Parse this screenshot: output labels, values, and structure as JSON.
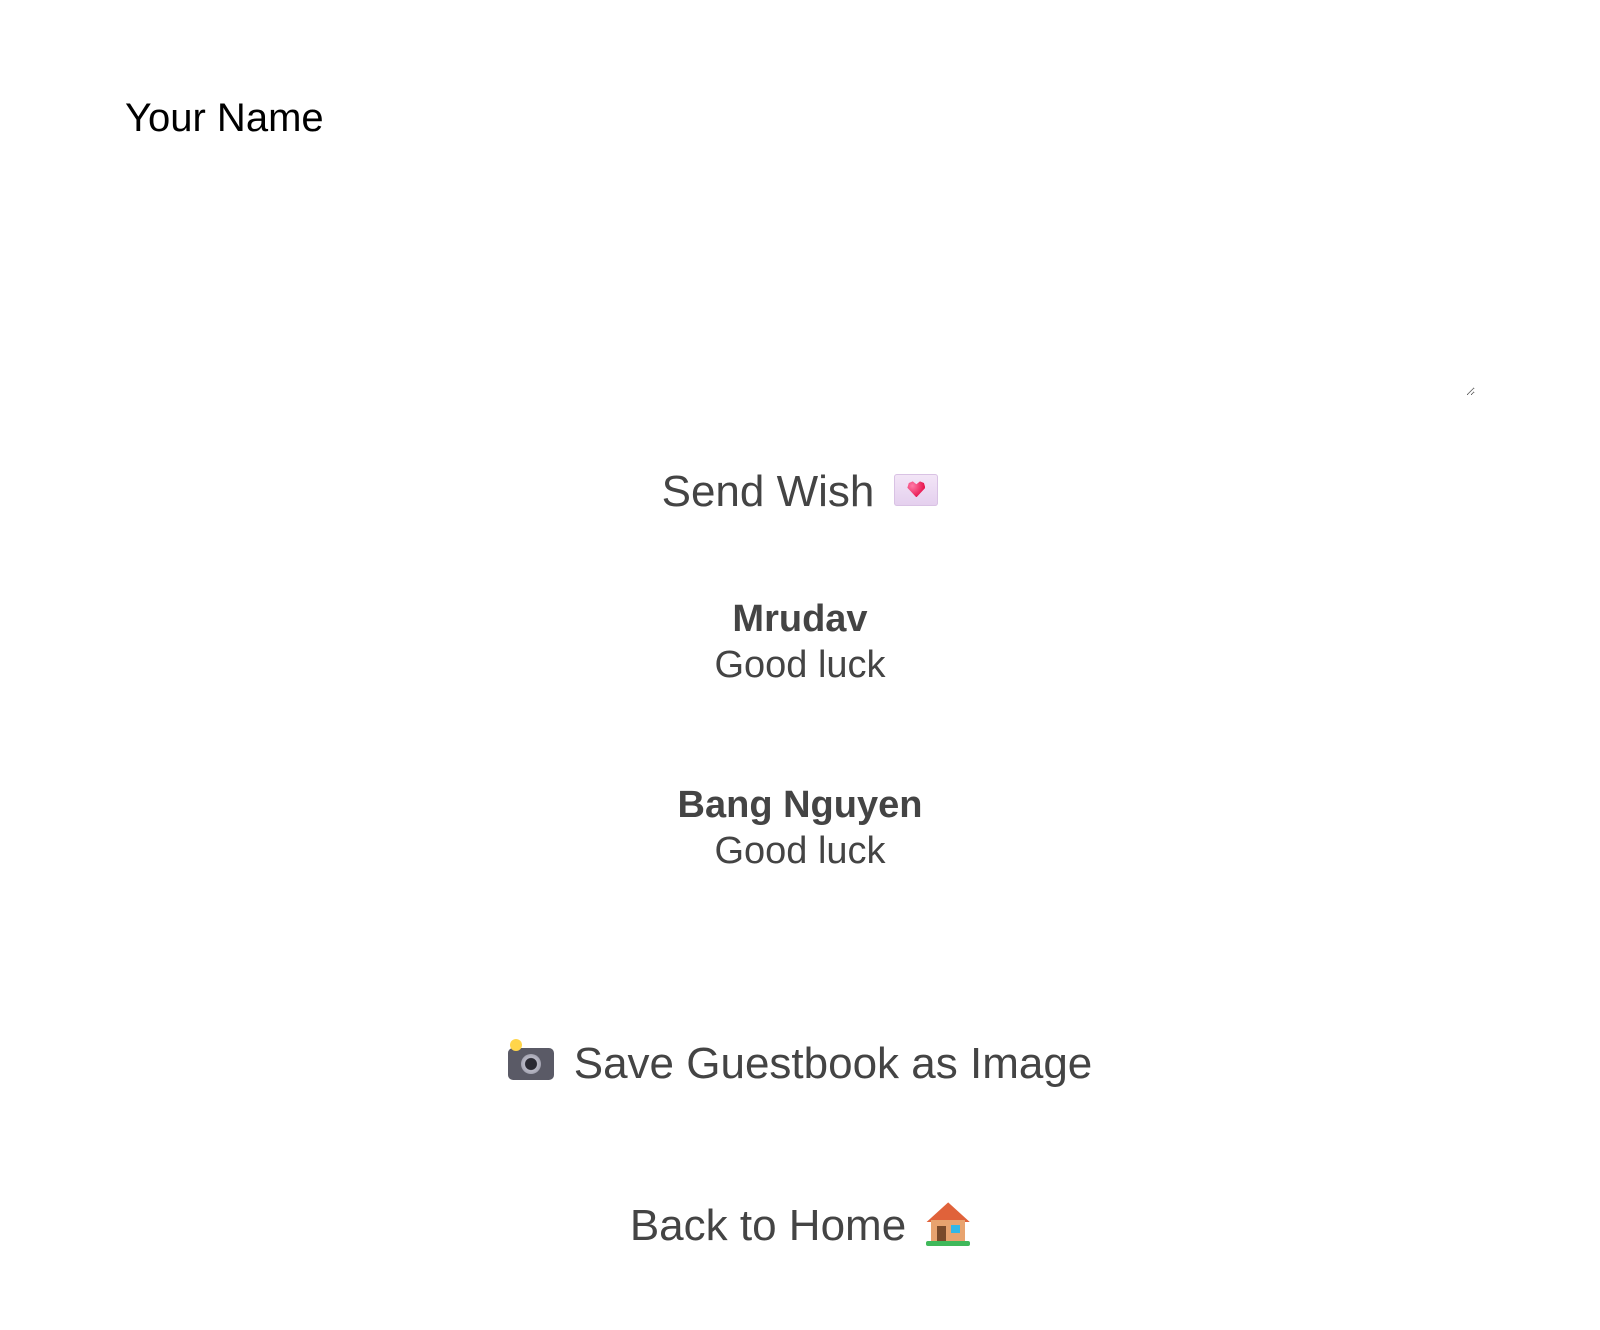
{
  "form": {
    "name_placeholder": "Your Name",
    "send_label": "Send Wish",
    "send_icon": "envelope-heart-icon"
  },
  "wishes": [
    {
      "author": "Mrudav",
      "message": "Good luck"
    },
    {
      "author": "Bang Nguyen",
      "message": "Good luck"
    }
  ],
  "actions": {
    "save_label": "Save Guestbook as Image",
    "save_icon": "camera-flash-icon",
    "home_label": "Back to Home",
    "home_icon": "house-icon"
  },
  "colors": {
    "text": "#444444",
    "heart": "#e8174f",
    "roof": "#e0623a"
  }
}
